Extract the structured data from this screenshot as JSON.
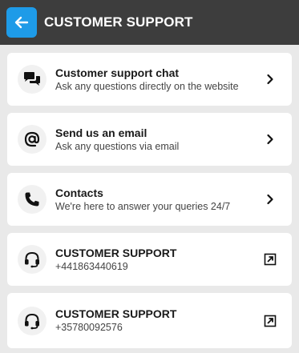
{
  "header": {
    "title": "CUSTOMER SUPPORT",
    "back_icon": "arrow-left-icon",
    "accent_color": "#1e9be8",
    "bar_color": "#3d3d3d"
  },
  "items": [
    {
      "title": "Customer support chat",
      "subtitle": "Ask any questions directly on the website",
      "icon": "chat-bubbles-icon",
      "trailing_icon": "chevron-right-icon"
    },
    {
      "title": "Send us an email",
      "subtitle": "Ask any questions via email",
      "icon": "at-sign-icon",
      "trailing_icon": "chevron-right-icon"
    },
    {
      "title": "Contacts",
      "subtitle": "We're here to answer your queries 24/7",
      "icon": "phone-icon",
      "trailing_icon": "chevron-right-icon"
    },
    {
      "title": "CUSTOMER SUPPORT",
      "subtitle": "+441863440619",
      "icon": "headset-icon",
      "trailing_icon": "external-link-icon"
    },
    {
      "title": "CUSTOMER SUPPORT",
      "subtitle": "+35780092576",
      "icon": "headset-icon",
      "trailing_icon": "external-link-icon"
    }
  ]
}
